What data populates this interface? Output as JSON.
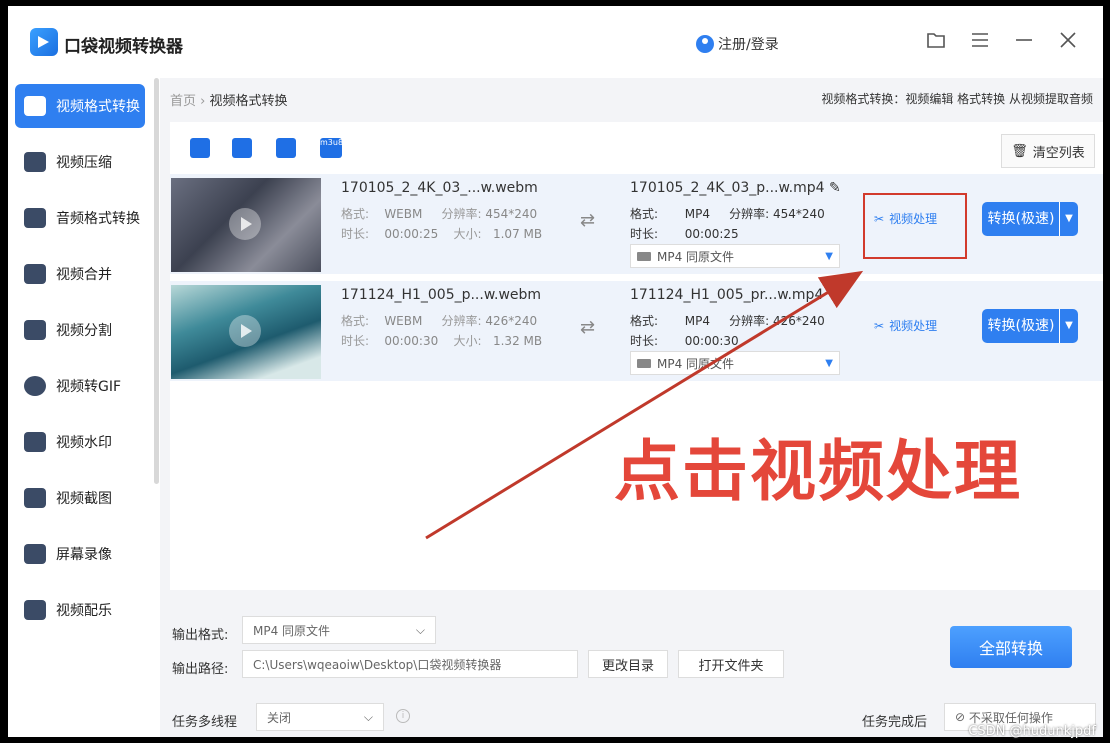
{
  "app": {
    "title": "口袋视频转换器",
    "login": "注册/登录",
    "icons": {
      "folder": "folder-icon",
      "menu": "menu-icon",
      "minimize": "minimize-icon",
      "close": "close-icon"
    }
  },
  "sidebar": {
    "items": [
      {
        "label": "视频格式转换",
        "active": true
      },
      {
        "label": "视频压缩"
      },
      {
        "label": "音频格式转换"
      },
      {
        "label": "视频合并"
      },
      {
        "label": "视频分割"
      },
      {
        "label": "视频转GIF"
      },
      {
        "label": "视频水印"
      },
      {
        "label": "视频截图"
      },
      {
        "label": "屏幕录像"
      },
      {
        "label": "视频配乐"
      }
    ]
  },
  "breadcrumb": {
    "home": "首页",
    "sep": "›",
    "current": "视频格式转换"
  },
  "breadcrumb_right": "视频格式转换：视频编辑 格式转换 从视频提取音频",
  "toolbar": {
    "clear": "清空列表",
    "m3u8": "m3u8"
  },
  "labels": {
    "format": "格式:",
    "resolution": "分辨率:",
    "duration": "时长:",
    "size": "大小:",
    "process": "视频处理",
    "convert": "转换(极速)"
  },
  "files": [
    {
      "src_name": "170105_2_4K_03_...w.webm",
      "src_format": "WEBM",
      "src_res": "454*240",
      "src_dur": "00:00:25",
      "src_size": "1.07 MB",
      "out_name": "170105_2_4K_03_p...w.mp4",
      "out_format": "MP4",
      "out_res": "454*240",
      "out_dur": "00:00:25",
      "out_option": "MP4  同原文件"
    },
    {
      "src_name": "171124_H1_005_p...w.webm",
      "src_format": "WEBM",
      "src_res": "426*240",
      "src_dur": "00:00:30",
      "src_size": "1.32 MB",
      "out_name": "171124_H1_005_pr...w.mp4",
      "out_format": "MP4",
      "out_res": "426*240",
      "out_dur": "00:00:30",
      "out_option": "MP4  同原文件"
    }
  ],
  "annotation": "点击视频处理",
  "bottom": {
    "out_format_label": "输出格式:",
    "out_format_value": "MP4  同原文件",
    "out_path_label": "输出路径:",
    "out_path_value": "C:\\Users\\wqeaoiw\\Desktop\\口袋视频转换器",
    "change_dir": "更改目录",
    "open_folder": "打开文件夹",
    "convert_all": "全部转换",
    "multi_label": "任务多线程",
    "multi_value": "关闭",
    "after_label": "任务完成后",
    "after_value": "不采取任何操作"
  },
  "watermark": "CSDN @hudunkjpdf",
  "colors": {
    "accent": "#2f7ff0",
    "annotation": "#e4473a"
  }
}
